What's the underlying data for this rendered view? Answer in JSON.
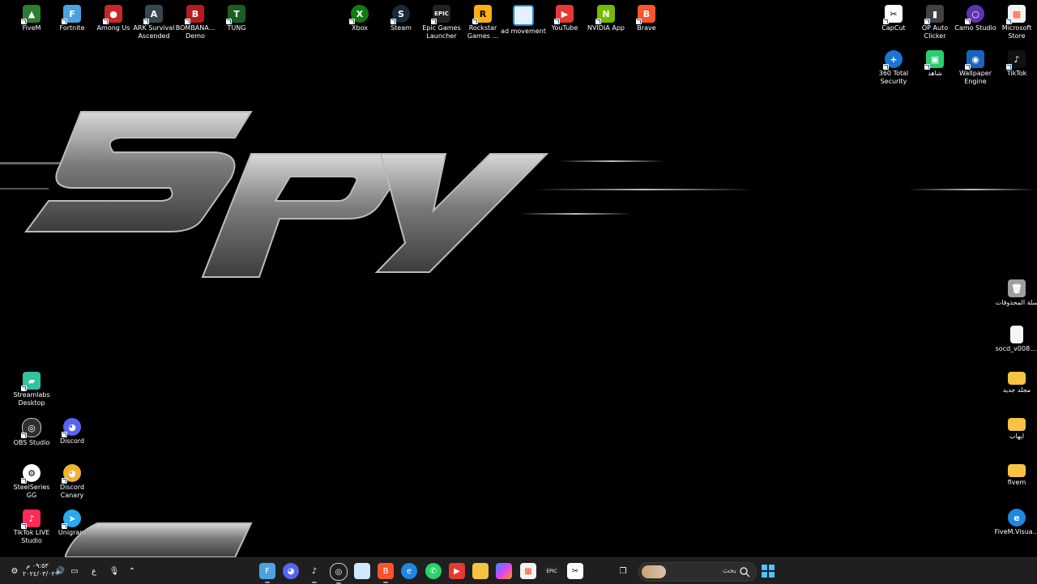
{
  "desktop": {
    "icons": [
      {
        "label": "FiveM",
        "color": "#2e7d32"
      },
      {
        "label": "Fortnite",
        "color": "#4aa3df"
      },
      {
        "label": "Among Us",
        "color": "#c62828"
      },
      {
        "label": "ARK Survival Ascended",
        "color": "#37474f"
      },
      {
        "label": "BOMBANA... Demo",
        "color": "#b71c1c"
      },
      {
        "label": "TUNG",
        "color": "#1b5e20"
      },
      {
        "label": "Xbox",
        "color": "#107c10"
      },
      {
        "label": "Steam",
        "color": "#1b2838"
      },
      {
        "label": "Epic Games Launcher",
        "color": "#222222"
      },
      {
        "label": "Rockstar Games ...",
        "color": "#fcaf17"
      },
      {
        "label": "ad movement",
        "color": "#1e88e5"
      },
      {
        "label": "YouTube",
        "color": "#e53935"
      },
      {
        "label": "NVIDIA App",
        "color": "#76b900"
      },
      {
        "label": "Brave",
        "color": "#fb542b"
      },
      {
        "label": "CapCut",
        "color": "#ffffff"
      },
      {
        "label": "OP Auto Clicker",
        "color": "#424242"
      },
      {
        "label": "Camo Studio",
        "color": "#5e35b1"
      },
      {
        "label": "Microsoft Store",
        "color": "#f3f3f3"
      },
      {
        "label": "360 Total Security",
        "color": "#1976d2"
      },
      {
        "label": "شاهد",
        "color": "#2ecc71"
      },
      {
        "label": "Wallpaper Engine",
        "color": "#1565c0"
      },
      {
        "label": "TikTok",
        "color": "#111111"
      },
      {
        "label": "سلة المحذوفات",
        "color": "#9e9e9e"
      },
      {
        "label": "socd_v008....",
        "color": "#f5f5f5"
      },
      {
        "label": "مجلد جديد",
        "color": "#f6c342"
      },
      {
        "label": "ايهاب",
        "color": "#f6c342"
      },
      {
        "label": "fivem",
        "color": "#f6c342"
      },
      {
        "label": "FiveM.Visua...",
        "color": "#1e88e5"
      },
      {
        "label": "Streamlabs Desktop",
        "color": "#31c3a2"
      },
      {
        "label": "OBS Studio",
        "color": "#302e31"
      },
      {
        "label": "Discord",
        "color": "#5865f2"
      },
      {
        "label": "SteelSeries GG",
        "color": "#ff5200"
      },
      {
        "label": "Discord Canary",
        "color": "#f0b232"
      },
      {
        "label": "TikTok LIVE Studio",
        "color": "#fe2c55"
      },
      {
        "label": "Unigram",
        "color": "#2aabee"
      }
    ]
  },
  "taskbar": {
    "clock_time": "٠٩:٥٣ م",
    "clock_date": "٢٠٢٤/٠٣/٠٢",
    "language": "ع",
    "search_placeholder": "بحث"
  }
}
